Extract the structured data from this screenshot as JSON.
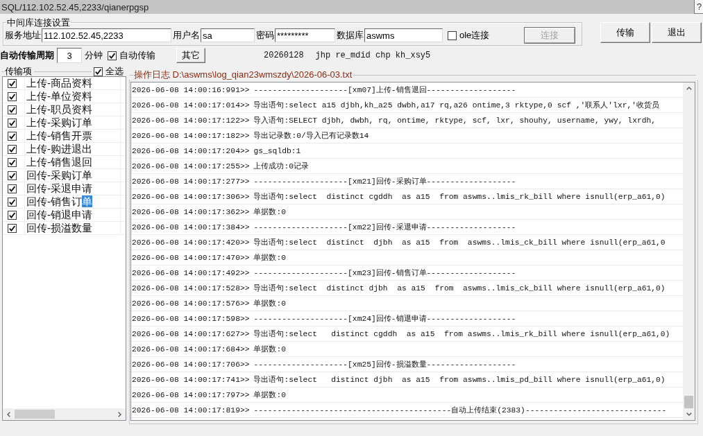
{
  "window": {
    "title": "SQL/112.102.52.45,2233/qianerpgsp",
    "help_button": "?"
  },
  "connection": {
    "title": "中间库连接设置",
    "fields": [
      {
        "label": "服务地址",
        "value": "112.102.52.45,2233"
      },
      {
        "label": "用户名",
        "value": "sa"
      },
      {
        "label": "密码",
        "value": "*********"
      },
      {
        "label": "数据库",
        "value": "aswms"
      }
    ],
    "ole": {
      "label": "ole连接",
      "checked": false
    },
    "connect_button": {
      "label": "连接",
      "disabled": true
    }
  },
  "actions": [
    {
      "label": "传输"
    },
    {
      "label": "退出"
    }
  ],
  "auto": {
    "label": "自动传输周期",
    "period": "3",
    "unit": "分钟",
    "auto_transfer": {
      "label": "自动传输",
      "checked": true
    },
    "other_button": "其它"
  },
  "info": [
    "20260128",
    "jhp re_mdid chp kh_xsy5"
  ],
  "transfer_items": {
    "title": "传输项",
    "select_all": {
      "label": "全选",
      "checked": true
    },
    "items": [
      {
        "label": "上传-商品资料",
        "checked": true,
        "selected": false
      },
      {
        "label": "上传-单位资料",
        "checked": true,
        "selected": false
      },
      {
        "label": "上传-职员资料",
        "checked": true,
        "selected": false
      },
      {
        "label": "上传-采购订单",
        "checked": true,
        "selected": false
      },
      {
        "label": "上传-销售开票",
        "checked": true,
        "selected": false
      },
      {
        "label": "上传-购进退出",
        "checked": true,
        "selected": false
      },
      {
        "label": "上传-销售退回",
        "checked": true,
        "selected": false
      },
      {
        "label": "回传-采购订单",
        "checked": true,
        "selected": false
      },
      {
        "label": "回传-采退申请",
        "checked": true,
        "selected": false
      },
      {
        "label": "回传-销售订单",
        "checked": true,
        "selected": true
      },
      {
        "label": "回传-销退申请",
        "checked": true,
        "selected": false
      },
      {
        "label": "回传-损溢数量",
        "checked": true,
        "selected": false
      }
    ]
  },
  "log": {
    "title": "操作日志 D:\\aswms\\log_qian23wmszdy\\2026-06-03.txt",
    "rows": [
      {
        "time": "2026-06-08 14:00:16:991>>",
        "message": "--------------------[xm07]上传-销售退回-------------------"
      },
      {
        "time": "2026-06-08 14:00:17:014>>",
        "message": "导出语句:select a15 djbh,kh_a25 dwbh,a17 rq,a26 ontime,3 rktype,0 scf ,'联系人'lxr,'收货员"
      },
      {
        "time": "2026-06-08 14:00:17:122>>",
        "message": "导入语句:SELECT djbh, dwbh, rq, ontime, rktype, scf, lxr, shouhy, username, ywy, lxrdh,"
      },
      {
        "time": "2026-06-08 14:00:17:182>>",
        "message": "导出记录数:0/导入已有记录数14"
      },
      {
        "time": "2026-06-08 14:00:17:204>>",
        "message": "gs_sqldb:1"
      },
      {
        "time": "2026-06-08 14:00:17:255>>",
        "message": "上传成功:0记录"
      },
      {
        "time": "2026-06-08 14:00:17:277>>",
        "message": "--------------------[xm21]回传-采购订单-------------------"
      },
      {
        "time": "2026-06-08 14:00:17:306>>",
        "message": "导出语句:select  distinct cgddh  as a15  from aswms..lmis_rk_bill where isnull(erp_a61,0)"
      },
      {
        "time": "2026-06-08 14:00:17:362>>",
        "message": "单据数:0"
      },
      {
        "time": "2026-06-08 14:00:17:384>>",
        "message": "--------------------[xm22]回传-采退申请-------------------"
      },
      {
        "time": "2026-06-08 14:00:17:420>>",
        "message": "导出语句:select  distinct  djbh  as a15  from  aswms..lmis_ck_bill where isnull(erp_a61,0"
      },
      {
        "time": "2026-06-08 14:00:17:470>>",
        "message": "单据数:0"
      },
      {
        "time": "2026-06-08 14:00:17:492>>",
        "message": "--------------------[xm23]回传-销售订单-------------------"
      },
      {
        "time": "2026-06-08 14:00:17:528>>",
        "message": "导出语句:select  distinct djbh  as a15  from  aswms..lmis_ck_bill where isnull(erp_a61,0)"
      },
      {
        "time": "2026-06-08 14:00:17:576>>",
        "message": "单据数:0"
      },
      {
        "time": "2026-06-08 14:00:17:598>>",
        "message": "--------------------[xm24]回传-销退申请-------------------"
      },
      {
        "time": "2026-06-08 14:00:17:627>>",
        "message": "导出语句:select   distinct cgddh  as a15  from aswms..lmis_rk_bill where isnull(erp_a61,0)"
      },
      {
        "time": "2026-06-08 14:00:17:684>>",
        "message": "单据数:0"
      },
      {
        "time": "2026-06-08 14:00:17:706>>",
        "message": "--------------------[xm25]回传-损溢数量-------------------"
      },
      {
        "time": "2026-06-08 14:00:17:741>>",
        "message": "导出语句:select   distinct djbh  as a15  from aswms..lmis_pd_bill where isnull(erp_a61,0)"
      },
      {
        "time": "2026-06-08 14:00:17:797>>",
        "message": "单据数:0"
      },
      {
        "time": "2026-06-08 14:00:17:819>>",
        "message": "------------------------------------------自动上传结束(2383)------------------------------"
      }
    ]
  }
}
